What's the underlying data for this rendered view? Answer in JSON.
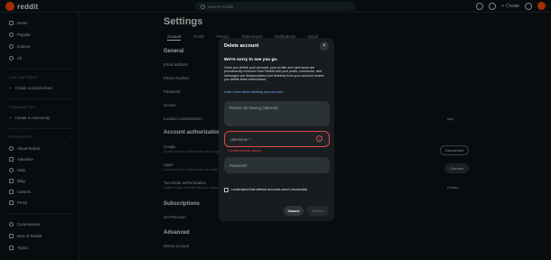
{
  "topbar": {
    "logo_text": "reddit",
    "search_placeholder": "Search Reddit",
    "create_label": "Create"
  },
  "sidebar": {
    "items_top": [
      {
        "label": "Home",
        "icon": "home-icon"
      },
      {
        "label": "Popular",
        "icon": "popular-icon"
      },
      {
        "label": "Explore",
        "icon": "explore-icon"
      },
      {
        "label": "All",
        "icon": "all-icon"
      }
    ],
    "custom_feeds_header": "CUSTOM FEEDS",
    "create_custom_feed": "Create a custom feed",
    "communities_header": "COMMUNITIES",
    "create_community": "Create a community",
    "resources_header": "RESOURCES",
    "resources": [
      {
        "label": "About Reddit",
        "icon": "reddit-icon"
      },
      {
        "label": "Advertise",
        "icon": "advertise-icon"
      },
      {
        "label": "Help",
        "icon": "help-icon"
      },
      {
        "label": "Blog",
        "icon": "blog-icon"
      },
      {
        "label": "Careers",
        "icon": "careers-icon"
      },
      {
        "label": "Press",
        "icon": "press-icon"
      }
    ],
    "bottom": [
      {
        "label": "Communities",
        "icon": "communities-icon"
      },
      {
        "label": "Best of Reddit",
        "icon": "best-icon"
      },
      {
        "label": "Topics",
        "icon": "topics-icon"
      }
    ]
  },
  "settings": {
    "title": "Settings",
    "tabs": [
      "Account",
      "Profile",
      "Privacy",
      "Preferences",
      "Notifications",
      "Email"
    ],
    "general_header": "General",
    "email": "Email address",
    "phone": "Phone Number",
    "password": "Password",
    "gender": "Gender",
    "location": "Location customization",
    "location_value": "Italy",
    "auth_header": "Account authorization",
    "google": "Google",
    "google_sub": "Connect to log in to Reddit with your Google account",
    "google_btn": "Disconnect",
    "apple": "Apple",
    "apple_sub": "Connect to log in to Reddit with your Apple account",
    "apple_btn": "Connect",
    "twofa": "Two-factor authentication",
    "twofa_sub": "Enable to log in to Reddit with your authenticator",
    "twofa_value": "Enable",
    "subs_header": "Subscriptions",
    "premium": "Get Premium",
    "advanced_header": "Advanced",
    "delete_account": "Delete account"
  },
  "modal": {
    "title": "Delete account",
    "close": "×",
    "sorry": "We're sorry to see you go.",
    "body": "Once you delete your account, your profile and username are permanently removed from Reddit and your posts, comments, and messages are disassociated (not deleted) from your account unless you delete them beforehand.",
    "learn_more": "Learn more about deleting your account",
    "reason_placeholder": "Reason for leaving (optional)",
    "username_label": "Username *",
    "error_icon": "!",
    "error_text": "Compila questo campo.",
    "password_label": "Password *",
    "checkbox_label": "I understand that deleted accounts aren't recoverable",
    "cancel": "Cancel",
    "delete": "Delete"
  },
  "colors": {
    "background": "#0b1416",
    "modal": "#181c1f",
    "accent": "#ff4500",
    "error": "#e04b4b",
    "link": "#7aa8ff"
  }
}
